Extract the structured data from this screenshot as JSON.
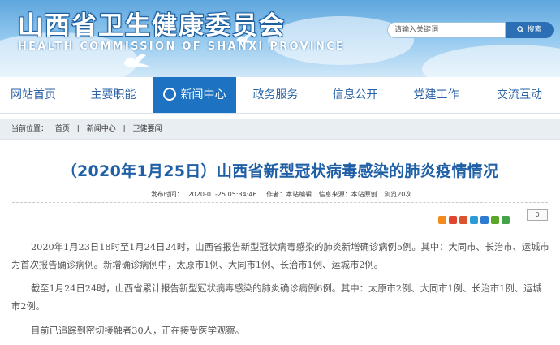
{
  "header": {
    "title_cn": "山西省卫生健康委员会",
    "title_en": "HEALTH COMMISSION OF SHANXI PROVINCE"
  },
  "search": {
    "placeholder": "请输入关键词",
    "button_label": "搜索"
  },
  "nav": {
    "items": [
      {
        "label": "网站首页"
      },
      {
        "label": "主要职能"
      },
      {
        "label": "新闻中心"
      },
      {
        "label": "政务服务"
      },
      {
        "label": "信息公开"
      },
      {
        "label": "党建工作"
      },
      {
        "label": "交流互动"
      }
    ]
  },
  "breadcrumb": {
    "prefix": "当前位置：",
    "items": [
      "首页",
      "新闻中心",
      "卫健要闻"
    ],
    "separator": "|"
  },
  "article": {
    "title": "（2020年1月25日）山西省新型冠状病毒感染的肺炎疫情情况",
    "meta": {
      "date_label": "发布时间：",
      "date": "2020-01-25 05:34:46",
      "author": "作者：本站编辑",
      "source": "信息来源：本站原创",
      "views": "浏览20次"
    },
    "share_count": "0",
    "paragraphs": [
      "2020年1月23日18时至1月24日24时，山西省报告新型冠状病毒感染的肺炎新增确诊病例5例。其中：大同市、长治市、运城市为首次报告确诊病例。新增确诊病例中，太原市1例、大同市1例、长治市1例、运城市2例。",
      "截至1月24日24时，山西省累计报告新型冠状病毒感染的肺炎确诊病例6例。其中：太原市2例、大同市1例、长治市1例、运城市2例。",
      "目前已追踪到密切接触者30人，正在接受医学观察。"
    ]
  },
  "colors": {
    "brand_blue": "#1d72c2",
    "title_blue": "#1f5fa6",
    "nav_text": "#2a62a6"
  }
}
